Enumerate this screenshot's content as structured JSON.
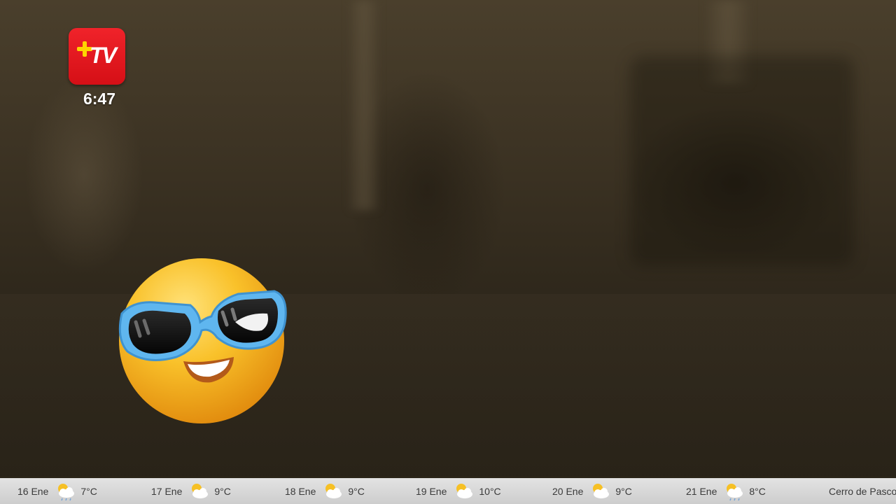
{
  "channel": {
    "logo_text": "TV",
    "time": "6:47"
  },
  "forecast": [
    {
      "date": "16 Ene",
      "icon": "partly-cloudy-rain-icon",
      "temp": "7°C"
    },
    {
      "date": "17 Ene",
      "icon": "partly-cloudy-icon",
      "temp": "9°C"
    },
    {
      "date": "18 Ene",
      "icon": "partly-cloudy-icon",
      "temp": "9°C"
    },
    {
      "date": "19 Ene",
      "icon": "partly-cloudy-icon",
      "temp": "10°C"
    },
    {
      "date": "20 Ene",
      "icon": "partly-cloudy-icon",
      "temp": "9°C"
    },
    {
      "date": "21 Ene",
      "icon": "partly-cloudy-rain-icon",
      "temp": "8°C"
    }
  ],
  "location": "Cerro de Pasco",
  "colors": {
    "logo_red": "#e3161d",
    "logo_plus": "#ffd400",
    "ticker_bg": "#d9d9d9",
    "emoji_yellow": "#f7b81a",
    "glasses_blue": "#5fb6ef"
  }
}
